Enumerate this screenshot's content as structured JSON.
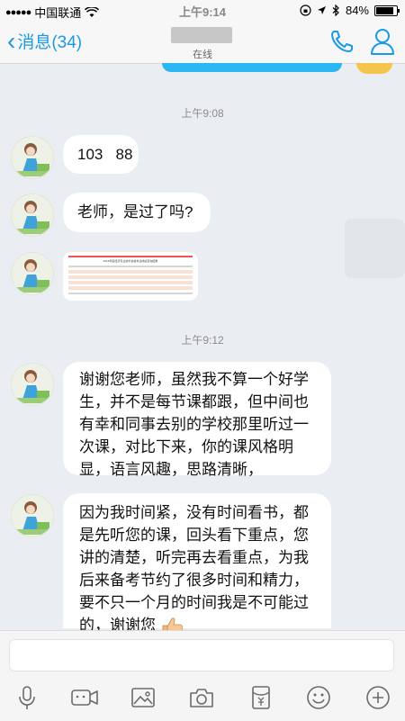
{
  "status_bar": {
    "signal": "●●●●●",
    "carrier": "中国联通",
    "time": "上午9:14",
    "battery": "84%"
  },
  "nav": {
    "back_label": "消息(34)",
    "contact_status": "在线"
  },
  "messages": [
    {
      "type": "timestamp",
      "text": "上午9:08"
    },
    {
      "type": "text",
      "text": "103   88"
    },
    {
      "type": "text",
      "text": "老师，是过了吗?"
    },
    {
      "type": "image",
      "caption": "2018年度经济专业技术资格考试成绩查询结果"
    },
    {
      "type": "timestamp",
      "text": "上午9:12"
    },
    {
      "type": "text",
      "lines": [
        "谢谢您老师，虽然我不算一个好学",
        "生，并不是每节课都跟，但中间也",
        "有幸和同事去别的学校那里听过一",
        "次课，对比下来，你的课风格明",
        "显，语言风趣，思路清晰，"
      ]
    },
    {
      "type": "text",
      "lines": [
        "因为我时间紧，没有时间看书，都",
        "是先听您的课，回头看下重点，您",
        "讲的清楚，听完再去看重点，为我",
        "后来备考节约了很多时间和精力，",
        "要不只一个月的时间我是不可能过",
        "的，谢谢您"
      ],
      "emoji": "thumbs-up-icon"
    }
  ],
  "input": {
    "placeholder": ""
  },
  "toolbar": [
    "microphone-icon",
    "video-icon",
    "image-icon",
    "camera-icon",
    "red-packet-icon",
    "emoji-icon",
    "plus-icon"
  ],
  "colors": {
    "accent": "#1a9ae6",
    "background": "#eaeef2",
    "bubble": "#ffffff"
  }
}
